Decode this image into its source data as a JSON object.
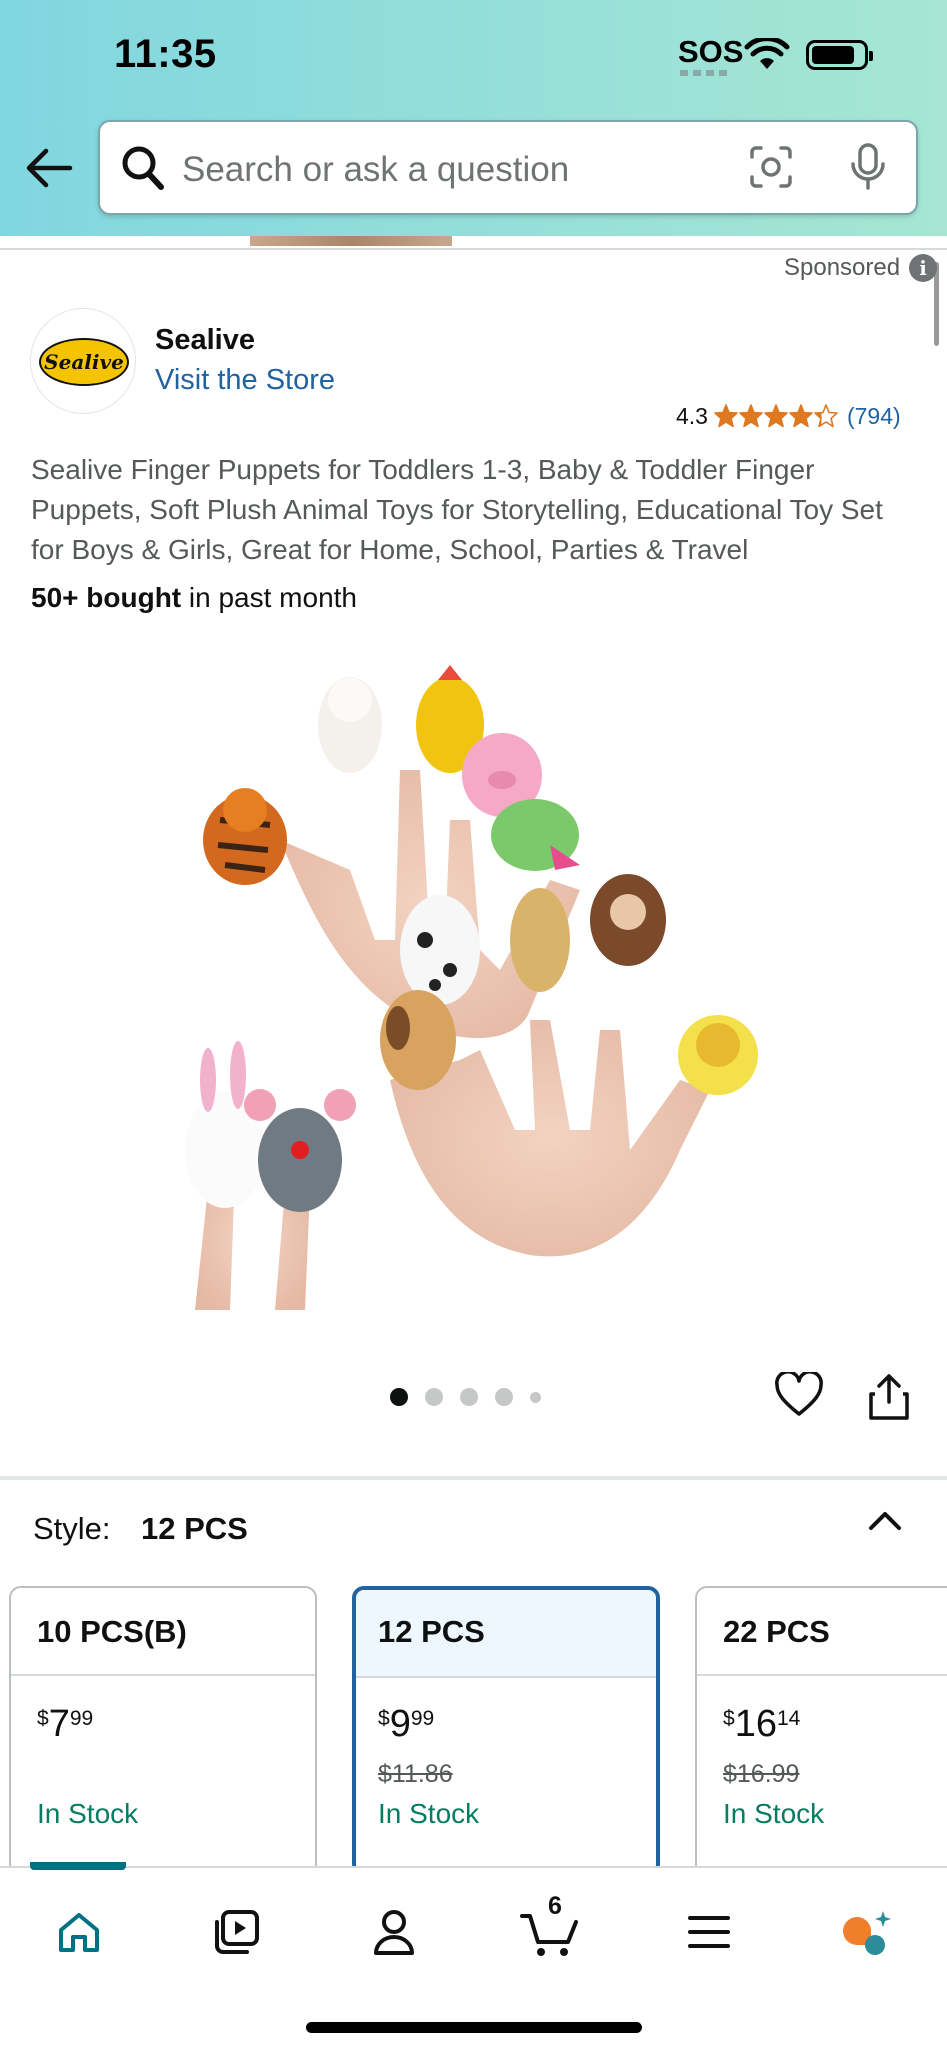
{
  "status_bar": {
    "time": "11:35",
    "carrier": "SOS"
  },
  "search": {
    "placeholder": "Search or ask a question"
  },
  "ad": {
    "sponsored_label": "Sponsored",
    "info_glyph": "i"
  },
  "store": {
    "logo_text": "Sealive",
    "name": "Sealive",
    "link": "Visit the Store"
  },
  "rating": {
    "value": "4.3",
    "stars": 4.3,
    "max_stars": 5,
    "count": "(794)"
  },
  "product": {
    "title": "Sealive Finger Puppets for Toddlers 1-3, Baby & Toddler Finger Puppets, Soft Plush Animal Toys for Storytelling, Educational Toy Set for Boys & Girls, Great for Home, School, Parties & Travel",
    "bought_bold": "50+ bought",
    "bought_rest": " in past month"
  },
  "carousel": {
    "total_dots": 5,
    "active_index": 0
  },
  "style_selector": {
    "label": "Style:",
    "value": "12 PCS",
    "options": [
      {
        "name": "10 PCS(B)",
        "currency": "$",
        "whole": "7",
        "cents": "99",
        "list_price": "",
        "stock": "In Stock",
        "selected": false
      },
      {
        "name": "12 PCS",
        "currency": "$",
        "whole": "9",
        "cents": "99",
        "list_price": "$11.86",
        "stock": "In Stock",
        "selected": true
      },
      {
        "name": "22 PCS",
        "currency": "$",
        "whole": "16",
        "cents": "14",
        "list_price": "$16.99",
        "stock": "In Stock",
        "selected": false
      }
    ]
  },
  "bottom_nav": {
    "items": [
      "home-icon",
      "video-icon",
      "account-icon",
      "cart-icon",
      "menu-icon",
      "rufus-icon"
    ],
    "active": "home-icon",
    "cart_count": "6"
  },
  "colors": {
    "accent_teal": "#007185",
    "link_blue": "#2162a1",
    "stock_green": "#067d62",
    "star_orange": "#de7921",
    "selected_border": "#2162a1"
  }
}
